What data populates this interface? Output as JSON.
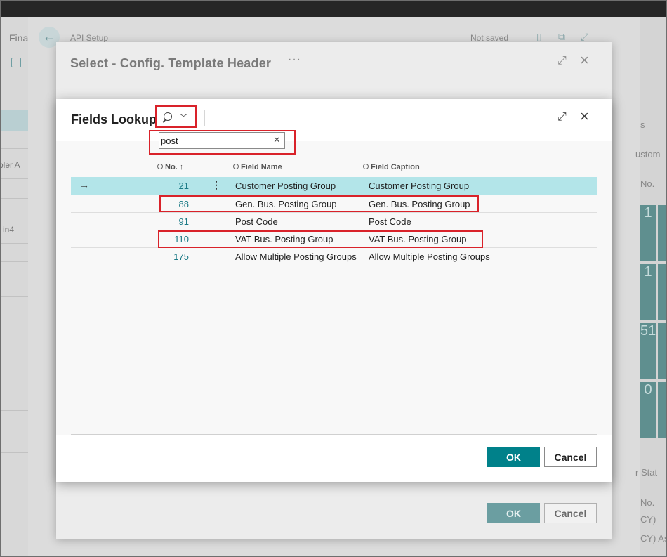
{
  "background": {
    "app_label": "Fina",
    "page_name": "API Setup",
    "save_status": "Not saved",
    "left_fragments": [
      "bler A",
      "in4"
    ],
    "right_fragments": [
      "s",
      "ustom",
      "No.",
      "r Stat",
      "No.",
      "CY)",
      "CY) As"
    ],
    "tile_values": [
      "1",
      "1",
      "51",
      "0"
    ]
  },
  "outer_dialog": {
    "title": "Select - Config. Template Header",
    "more_label": "···",
    "ok_label": "OK",
    "cancel_label": "Cancel"
  },
  "dialog": {
    "title": "Fields Lookup",
    "search": {
      "value": "post",
      "placeholder": ""
    },
    "columns": {
      "no": "No.",
      "sort_indicator": "↑",
      "field_name": "Field Name",
      "field_caption": "Field Caption"
    },
    "rows": [
      {
        "no": "21",
        "field_name": "Customer Posting Group",
        "field_caption": "Customer Posting Group",
        "selected": true
      },
      {
        "no": "88",
        "field_name": "Gen. Bus. Posting Group",
        "field_caption": "Gen. Bus. Posting Group",
        "selected": false
      },
      {
        "no": "91",
        "field_name": "Post Code",
        "field_caption": "Post Code",
        "selected": false
      },
      {
        "no": "110",
        "field_name": "VAT Bus. Posting Group",
        "field_caption": "VAT Bus. Posting Group",
        "selected": false
      },
      {
        "no": "175",
        "field_name": "Allow Multiple Posting Groups",
        "field_caption": "Allow Multiple Posting Groups",
        "selected": false
      }
    ],
    "ok_label": "OK",
    "cancel_label": "Cancel"
  },
  "icons": {
    "back": "arrow-left-icon",
    "bookmark": "bookmark-icon",
    "open_new": "open-in-new-window-icon",
    "expand": "expand-icon",
    "close": "close-icon",
    "search": "search-icon",
    "row_pointer": "arrow-right-icon",
    "row_menu": "vertical-ellipsis-icon"
  },
  "colors": {
    "accent": "#00818a",
    "selection": "#b3e5e9",
    "highlight_box": "#d9222a"
  }
}
